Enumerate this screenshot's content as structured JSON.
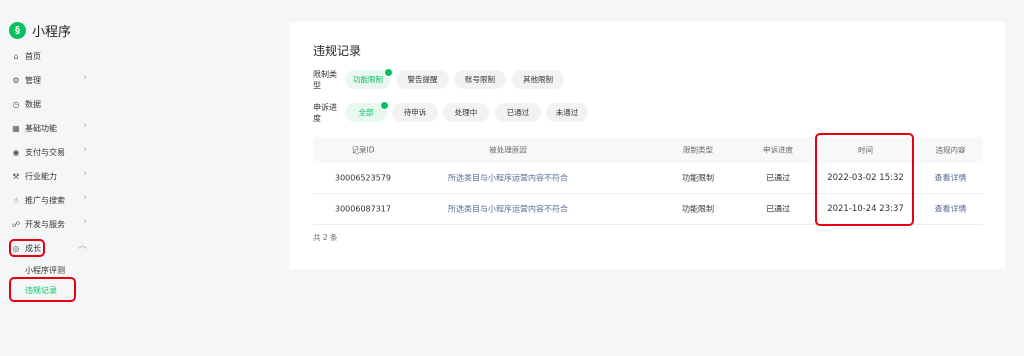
{
  "sidebar": {
    "app_name": "小程序",
    "items": [
      {
        "label": "首页",
        "icon": "home-icon",
        "glyph": "⌂",
        "arrow": false
      },
      {
        "label": "管理",
        "icon": "gear-icon",
        "glyph": "⚙",
        "arrow": true
      },
      {
        "label": "数据",
        "icon": "clock-icon",
        "glyph": "◷",
        "arrow": false
      },
      {
        "label": "基础功能",
        "icon": "grid-icon",
        "glyph": "▦",
        "arrow": true
      },
      {
        "label": "支付与交易",
        "icon": "payment-icon",
        "glyph": "◉",
        "arrow": true
      },
      {
        "label": "行业能力",
        "icon": "industry-icon",
        "glyph": "⚒",
        "arrow": true
      },
      {
        "label": "推广与搜索",
        "icon": "promote-icon",
        "glyph": "☝",
        "arrow": true
      },
      {
        "label": "开发与服务",
        "icon": "dev-icon",
        "glyph": "☍",
        "arrow": true
      },
      {
        "label": "成长",
        "icon": "growth-icon",
        "glyph": "◎",
        "arrow": true,
        "expanded": true
      }
    ],
    "sub_items": [
      "小程序评测",
      "违规记录"
    ]
  },
  "main": {
    "title": "违规记录",
    "filters": [
      {
        "label": "限制类型",
        "options": [
          "功能限制",
          "警告提醒",
          "账号限制",
          "其他限制"
        ],
        "active": 0
      },
      {
        "label": "申诉进度",
        "options": [
          "全部",
          "待申诉",
          "处理中",
          "已通过",
          "未通过"
        ],
        "active": 0
      }
    ],
    "table": {
      "headers": [
        "记录ID",
        "被处理原因",
        "限制类型",
        "申诉进度",
        "时间",
        "违规内容"
      ],
      "rows": [
        [
          "30006523579",
          "所选类目与小程序运营内容不符合",
          "功能限制",
          "已通过",
          "2022-03-02 15:32",
          "查看详情"
        ],
        [
          "30006087317",
          "所选类目与小程序运营内容不符合",
          "功能限制",
          "已通过",
          "2021-10-24 23:37",
          "查看详情"
        ]
      ]
    },
    "total": "共 2 条"
  },
  "colors": {
    "accent": "#07c160",
    "link": "#576b95",
    "highlight": "#e60012"
  }
}
